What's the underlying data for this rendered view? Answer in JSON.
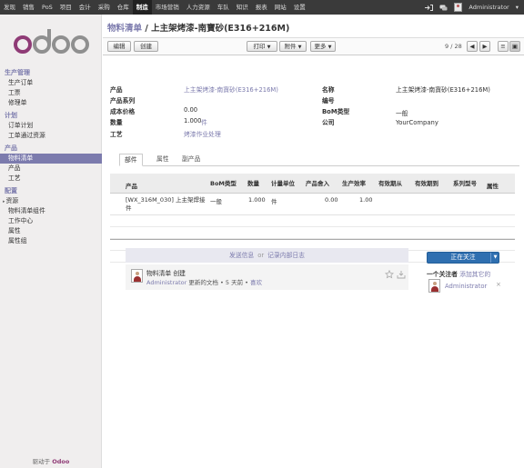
{
  "topbar": {
    "menu": [
      "发现",
      "销售",
      "PoS",
      "项目",
      "会计",
      "采购",
      "仓库",
      "制造",
      "市场营销",
      "人力资源",
      "车队",
      "知识",
      "报表",
      "网站",
      "设置"
    ],
    "active": "制造",
    "user": "Administrator"
  },
  "sidebar": {
    "logo": "odoo",
    "sections": [
      {
        "title": "生产管理",
        "items": [
          "生产订单",
          "工票",
          "修理单"
        ]
      },
      {
        "title": "计划",
        "items": [
          "订单计划",
          "工单通过资源"
        ]
      },
      {
        "title": "产品",
        "items": [
          "物料清单",
          "产品",
          "工艺"
        ]
      },
      {
        "title": "配置",
        "items": [
          "资源",
          "物料清单组件",
          "工作中心",
          "属性",
          "属性组"
        ]
      }
    ],
    "selected_item": "物料清单",
    "powered_by": "驱动于",
    "powered_brand": "Odoo"
  },
  "breadcrumb": {
    "parent": "物料清单",
    "separator": "/",
    "current": "上主架烤漆-南寶砂(E316+216M)"
  },
  "toolbar": {
    "edit": "编辑",
    "create": "创建",
    "print": "打印",
    "attachment": "附件",
    "more": "更多",
    "pager": "9 / 28"
  },
  "form": {
    "product_label": "产品",
    "product_value": "上主架烤漆-南寶砂(E316+216M)",
    "variant_label": "产品系列",
    "cost_label": "成本价格",
    "cost_value": "0.00",
    "qty_label": "数量",
    "qty_value": "1.000",
    "qty_unit": "件",
    "routing_label": "工艺",
    "routing_value": "烤漆作业处理",
    "name_label": "名称",
    "name_value": "上主架烤漆-南寶砂(E316+216M)",
    "code_label": "编号",
    "type_label": "BoM类型",
    "type_value": "一般",
    "company_label": "公司",
    "company_value": "YourCompany"
  },
  "tabs": [
    "部件",
    "属性",
    "副产品"
  ],
  "grid": {
    "headers": [
      "产品",
      "BoM类型",
      "数量",
      "计量单位",
      "产品舍入",
      "生产效率",
      "有效期从",
      "有效期到",
      "系列型号",
      "属性"
    ],
    "rows": [
      {
        "product": "[WX_316M_030] 上主架焊接件",
        "type": "一般",
        "qty": "1.000",
        "uom": "件",
        "rounding": "0.00",
        "efficiency": "1.00"
      }
    ]
  },
  "chatter": {
    "send_message": "发送信息",
    "or": "or",
    "log_note": "记录内部日志",
    "message_title": "物料清单 创建",
    "message_author": "Administrator",
    "message_rest": "更新的文档 •",
    "message_time": "5 天前",
    "message_like": "喜欢",
    "follow_button": "正在关注",
    "followers_count": "一个关注者",
    "add_others": "添加其它的",
    "follower": "Administrator",
    "remove": "×"
  },
  "colors": {
    "brand": "#7c7bad",
    "follow": "#2f6fb0",
    "topbar": "#3a3a3a"
  }
}
